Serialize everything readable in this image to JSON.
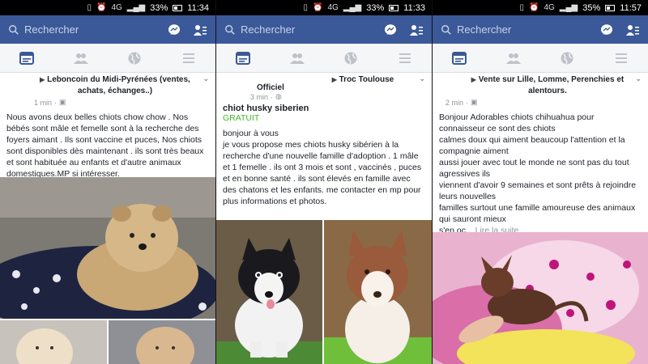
{
  "colors": {
    "facebook_blue": "#3b5998",
    "price_green": "#42b72a",
    "meta_gray": "#90949c"
  },
  "panels": [
    {
      "status": {
        "battery": "33%",
        "time": "11:34",
        "network": "4G"
      },
      "search_placeholder": "Rechercher",
      "group": "Leboncoin du Midi-Pyrénées (ventes, achats, échanges..)",
      "time_ago": "1 min",
      "text": "Nous avons deux belles chiots chow chow . Nos bébés sont mâle et femelle sont à la recherche des foyers aimant . Ils sont vaccine et puces, Nos chiots sont disponibles dès maintenant . ils sont très beaux et sont habituée au enfants et d'autre animaux domestiques.MP si intéresser."
    },
    {
      "status": {
        "battery": "33%",
        "time": "11:33",
        "network": "4G"
      },
      "search_placeholder": "Rechercher",
      "group_prefix": "Officiel",
      "group": "Troc Toulouse",
      "time_ago": "3 min",
      "sale_title": "chiot husky siberien",
      "price": "GRATUIT",
      "text": "bonjour à vous\nje vous propose mes chiots husky sibérien à la recherche d'une nouvelle famille d'adoption . 1 mâle et 1 femelle . ils ont 3 mois et sont , vaccinés , puces et en bonne santé . ils sont élevés en famille avec des chatons et les enfants. me contacter en mp pour plus informations et photos."
    },
    {
      "status": {
        "battery": "35%",
        "time": "11:57",
        "network": "4G"
      },
      "search_placeholder": "Rechercher",
      "group": "Vente sur Lille, Lomme, Perenchies et alentours.",
      "time_ago": "2 min",
      "text": "Bonjour Adorables chiots chihuahua pour connaisseur ce sont des chiots\ncalmes doux qui aiment beaucoup l'attention et la compagnie aiment\naussi jouer avec tout le monde ne sont pas du tout agressives ils\nviennent d'avoir 9 semaines et sont prêts à rejoindre leurs nouvelles\nfamilles surtout une famille amoureuse des animaux qui sauront mieux\ns'en oc...",
      "see_more": "Lire la suite"
    }
  ]
}
